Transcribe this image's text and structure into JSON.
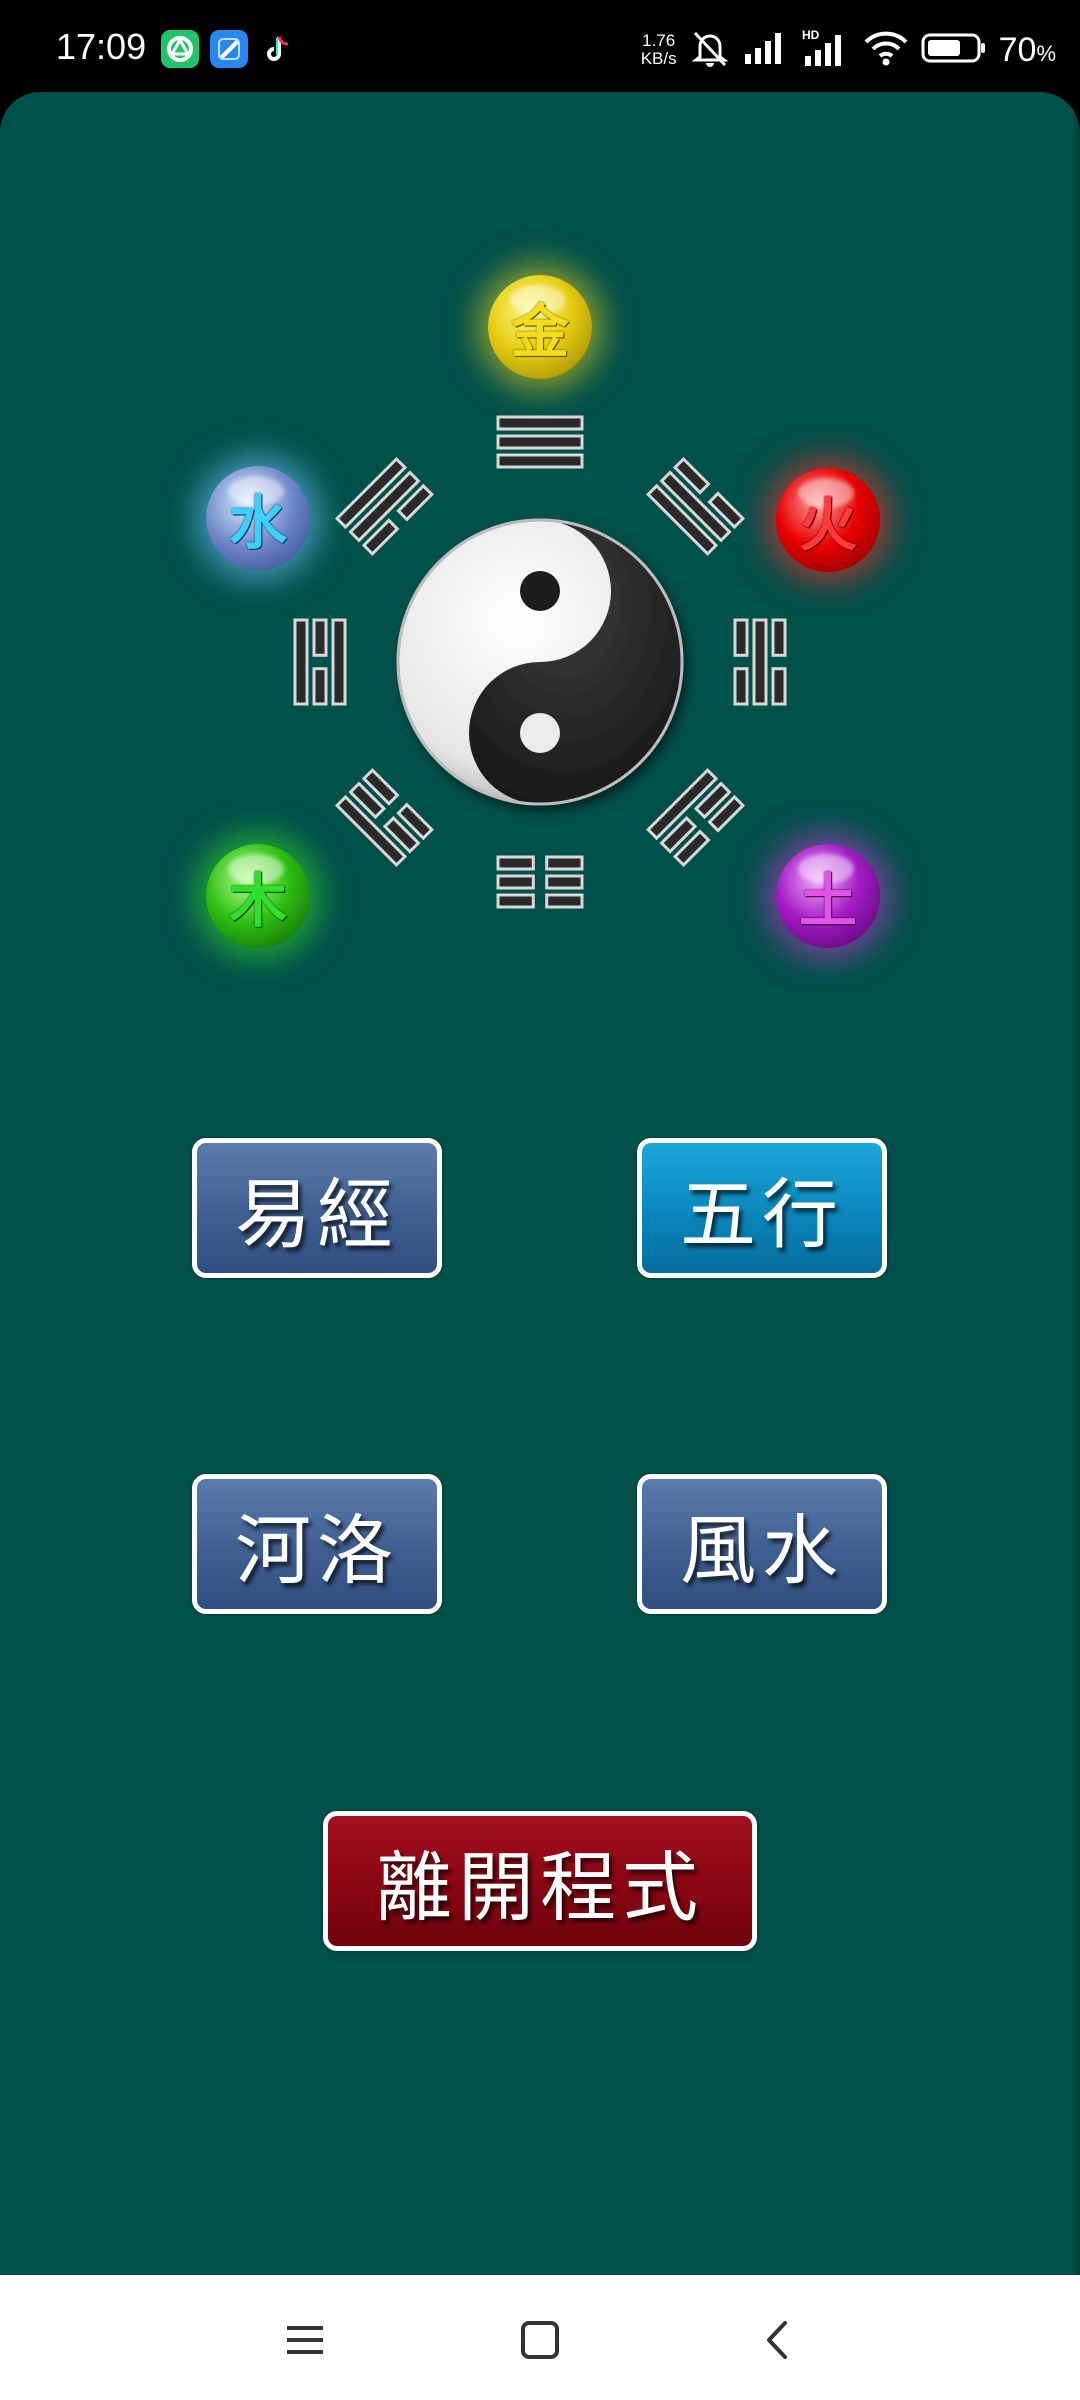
{
  "status_bar": {
    "time": "17:09",
    "net_speed_value": "1.76",
    "net_speed_unit": "KB/s",
    "battery_percent": "70",
    "battery_level": 0.7,
    "app_icons": [
      "green-app-icon",
      "blue-app-icon",
      "tiktok-icon"
    ],
    "icons": [
      "mute-bell-icon",
      "signal-icon",
      "hd-signal-icon",
      "wifi-icon",
      "battery-icon"
    ]
  },
  "bagua": {
    "elements": [
      {
        "char": "金",
        "name": "metal",
        "color": "#f1de1d",
        "glow": "#e8d31a"
      },
      {
        "char": "火",
        "name": "fire",
        "color": "#ff3030",
        "glow": "#ff2a2a"
      },
      {
        "char": "水",
        "name": "water",
        "color": "#35c9ff",
        "glow": "#6fc6ff"
      },
      {
        "char": "木",
        "name": "wood",
        "color": "#2cd12a",
        "glow": "#35e030"
      },
      {
        "char": "土",
        "name": "earth",
        "color": "#d64bd6",
        "glow": "#c23ad0"
      }
    ],
    "trigrams": [
      "qian",
      "xun",
      "kan",
      "gen",
      "kun",
      "zhen",
      "li",
      "dui"
    ]
  },
  "menu": {
    "yijing": "易經",
    "wuxing": "五行",
    "heluo": "河洛",
    "fengshui": "風水",
    "exit": "離開程式"
  },
  "nav": {
    "icons": [
      "menu-icon",
      "home-icon",
      "back-icon"
    ]
  },
  "colors": {
    "background": "#02504a",
    "button_steel": "#4a6b9e",
    "button_cyan": "#0a86bb",
    "button_exit": "#8a0613"
  }
}
